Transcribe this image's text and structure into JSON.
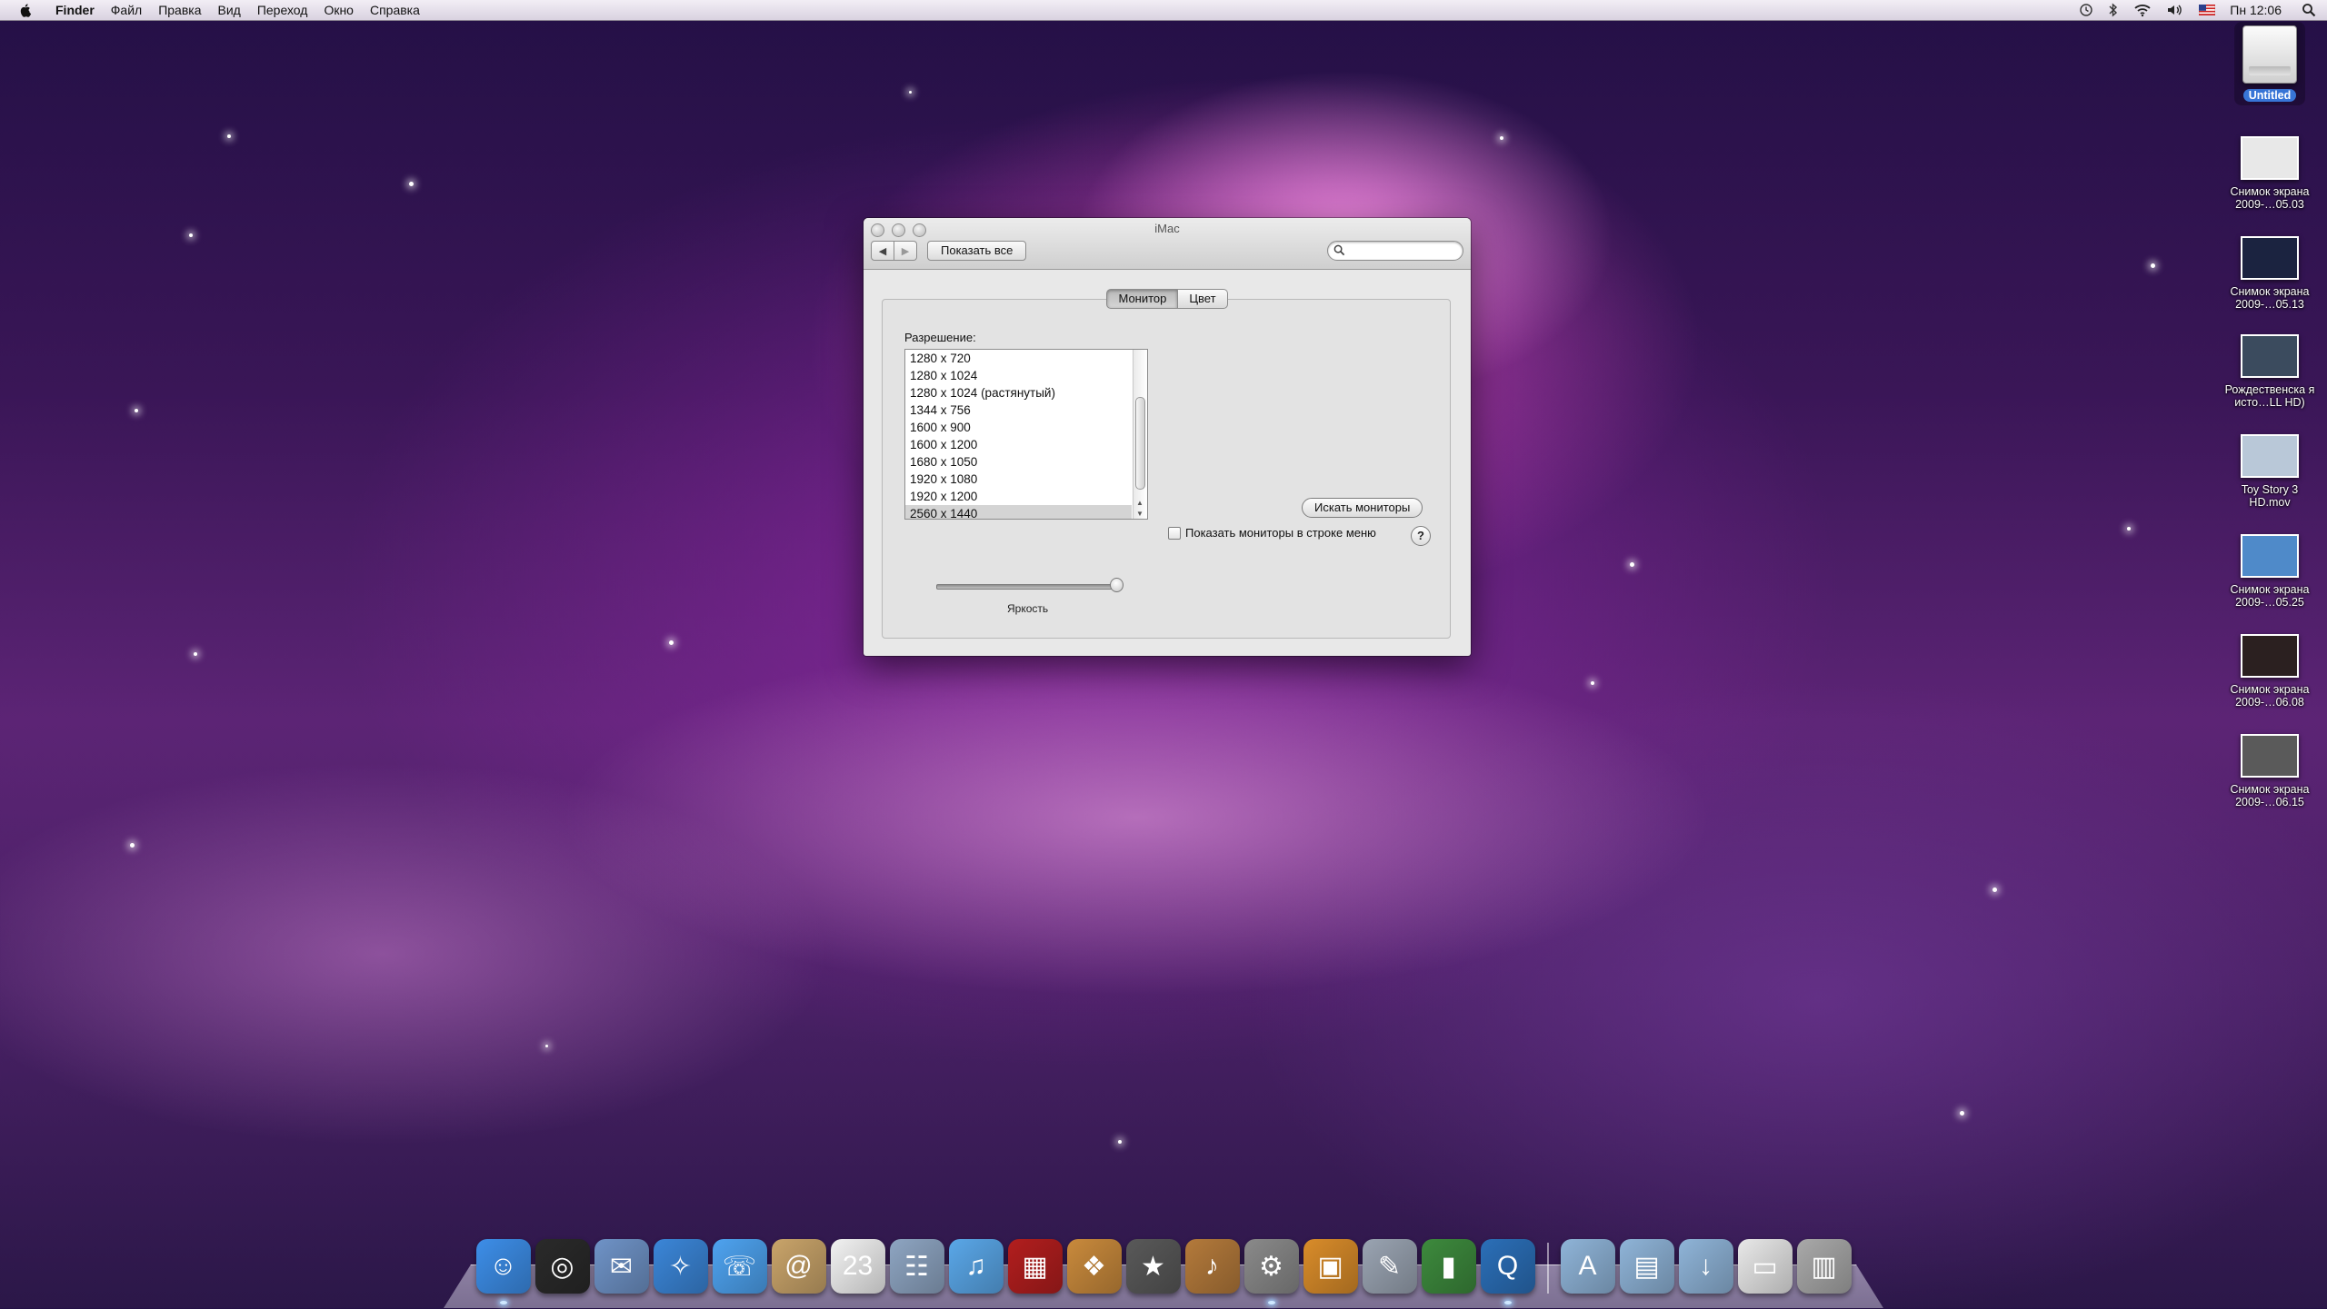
{
  "menubar": {
    "app_name": "Finder",
    "items": [
      "Файл",
      "Правка",
      "Вид",
      "Переход",
      "Окно",
      "Справка"
    ],
    "clock": "Пн 12:06"
  },
  "window": {
    "title": "iMac",
    "show_all": "Показать все",
    "search_placeholder": "",
    "tabs": [
      {
        "label": "Монитор",
        "selected": true
      },
      {
        "label": "Цвет",
        "selected": false
      }
    ],
    "resolution_label": "Разрешение:",
    "resolutions": [
      "1280 x 720",
      "1280 x 1024",
      "1280 x 1024 (растянутый)",
      "1344 x 756",
      "1600 x 900",
      "1600 x 1200",
      "1680 x 1050",
      "1920 x 1080",
      "1920 x 1200",
      "2560 x 1440"
    ],
    "selected_resolution": "2560 x 1440",
    "detect_button": "Искать мониторы",
    "show_in_menubar_label": "Показать мониторы в строке меню",
    "show_in_menubar_checked": false,
    "help_label": "?",
    "brightness_label": "Яркость",
    "brightness_level": 1.0
  },
  "desktop_icons": [
    {
      "label": "Untitled",
      "kind": "disk",
      "selected": true
    },
    {
      "label": "Снимок экрана 2009-…05.03",
      "kind": "screenshot",
      "color": "#e8e8e8"
    },
    {
      "label": "Снимок экрана 2009-…05.13",
      "kind": "screenshot",
      "color": "#1b2340"
    },
    {
      "label": "Рождественска я исто…LL HD)",
      "kind": "movie",
      "color": "#3b4b5e"
    },
    {
      "label": "Toy Story 3 HD.mov",
      "kind": "movie",
      "color": "#b9c8d8"
    },
    {
      "label": "Снимок экрана 2009-…05.25",
      "kind": "screenshot",
      "color": "#4f8ac9"
    },
    {
      "label": "Снимок экрана 2009-…06.08",
      "kind": "screenshot",
      "color": "#2b2020"
    },
    {
      "label": "Снимок экрана 2009-…06.15",
      "kind": "screenshot",
      "color": "#5a5a5a"
    }
  ],
  "dock": {
    "apps": [
      {
        "name": "finder-icon",
        "color": "#3d8ee8",
        "glyph": "☺",
        "running": true
      },
      {
        "name": "dashboard-icon",
        "color": "#2a2a2a",
        "glyph": "◎",
        "running": false
      },
      {
        "name": "mail-icon",
        "color": "#6f93c7",
        "glyph": "✉",
        "running": false
      },
      {
        "name": "safari-icon",
        "color": "#3b86d8",
        "glyph": "✧",
        "running": false
      },
      {
        "name": "ichat-icon",
        "color": "#4ea3f0",
        "glyph": "☏",
        "running": false
      },
      {
        "name": "address-book-icon",
        "color": "#c9a46a",
        "glyph": "@",
        "running": false
      },
      {
        "name": "ical-icon",
        "color": "#f2f2f2",
        "glyph": "23",
        "running": false
      },
      {
        "name": "preview-icon",
        "color": "#8ea5c2",
        "glyph": "☷",
        "running": false
      },
      {
        "name": "itunes-icon",
        "color": "#5aa7e8",
        "glyph": "♫",
        "running": false
      },
      {
        "name": "front-row-icon",
        "color": "#b21e1e",
        "glyph": "▦",
        "running": false
      },
      {
        "name": "iphoto-icon",
        "color": "#c98a3c",
        "glyph": "❖",
        "running": false
      },
      {
        "name": "imovie-icon",
        "color": "#595959",
        "glyph": "★",
        "running": false
      },
      {
        "name": "garageband-icon",
        "color": "#b47a3b",
        "glyph": "♪",
        "running": false
      },
      {
        "name": "system-preferences-icon",
        "color": "#8a8a8a",
        "glyph": "⚙",
        "running": true
      },
      {
        "name": "keynote-icon",
        "color": "#d98c2a",
        "glyph": "▣",
        "running": false
      },
      {
        "name": "script-editor-icon",
        "color": "#9aa4b2",
        "glyph": "✎",
        "running": false
      },
      {
        "name": "numbers-icon",
        "color": "#3d8a3d",
        "glyph": "▮",
        "running": false
      },
      {
        "name": "quicktime-icon",
        "color": "#2b6fb8",
        "glyph": "Q",
        "running": true
      }
    ],
    "stacks": [
      {
        "name": "applications-folder-icon",
        "color": "#8fb4d8",
        "glyph": "A"
      },
      {
        "name": "documents-folder-icon",
        "color": "#8fb4d8",
        "glyph": "▤"
      },
      {
        "name": "downloads-folder-icon",
        "color": "#8fb4d8",
        "glyph": "↓"
      },
      {
        "name": "screenshot-stack-icon",
        "color": "#e8e8e8",
        "glyph": "▭"
      },
      {
        "name": "trash-icon",
        "color": "#a9a9a9",
        "glyph": "▥"
      }
    ]
  }
}
